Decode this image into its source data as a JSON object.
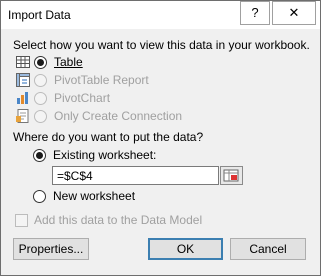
{
  "window": {
    "title": "Import Data",
    "help_glyph": "?",
    "close_glyph": "✕"
  },
  "view_section": {
    "prompt": "Select how you want to view this data in your workbook.",
    "options": [
      {
        "label": "Table",
        "selected": true,
        "enabled": true,
        "icon": "table-icon"
      },
      {
        "label": "PivotTable Report",
        "selected": false,
        "enabled": false,
        "icon": "pivottable-icon"
      },
      {
        "label": "PivotChart",
        "selected": false,
        "enabled": false,
        "icon": "pivotchart-icon"
      },
      {
        "label": "Only Create Connection",
        "selected": false,
        "enabled": false,
        "icon": "connection-icon"
      }
    ]
  },
  "location_section": {
    "prompt": "Where do you want to put the data?",
    "existing_label": "Existing worksheet:",
    "existing_selected": true,
    "reference_value": "=$C$4",
    "new_label": "New worksheet",
    "new_selected": false
  },
  "data_model": {
    "label": "Add this data to the Data Model",
    "checked": false,
    "enabled": false
  },
  "buttons": {
    "properties": "Properties...",
    "ok": "OK",
    "cancel": "Cancel"
  },
  "colors": {
    "accent": "#3c7fb1",
    "disabled_text": "#a0a0a0"
  }
}
